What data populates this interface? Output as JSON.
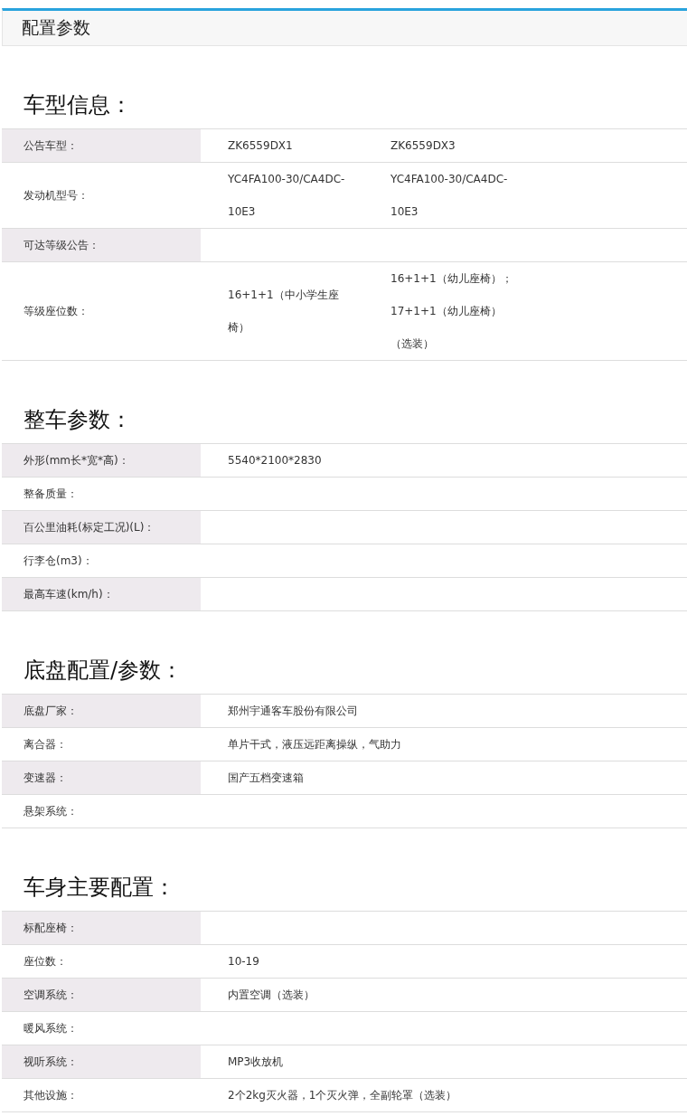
{
  "header": {
    "title": "配置参数"
  },
  "sections": [
    {
      "title": "车型信息：",
      "rows": [
        {
          "label": "公告车型：",
          "values": [
            "ZK6559DX1",
            "ZK6559DX3"
          ]
        },
        {
          "label": "发动机型号：",
          "values": [
            "YC4FA100-30/CA4DC-10E3",
            "YC4FA100-30/CA4DC-10E3"
          ]
        },
        {
          "label": "可达等级公告："
        },
        {
          "label": "等级座位数：",
          "values": [
            "16+1+1（中小学生座椅）",
            "16+1+1（幼儿座椅）；17+1+1（幼儿座椅）（选装）"
          ]
        }
      ]
    },
    {
      "title": "整车参数：",
      "rows": [
        {
          "label": "外形(mm长*宽*高)：",
          "values": [
            "5540*2100*2830"
          ]
        },
        {
          "label": "整备质量："
        },
        {
          "label": "百公里油耗(标定工况)(L)："
        },
        {
          "label": "行李仓(m3)："
        },
        {
          "label": "最高车速(km/h)："
        }
      ]
    },
    {
      "title": "底盘配置/参数：",
      "rows": [
        {
          "label": "底盘厂家：",
          "values": [
            "郑州宇通客车股份有限公司"
          ]
        },
        {
          "label": "离合器：",
          "values": [
            "单片干式，液压远距离操纵，气助力"
          ]
        },
        {
          "label": "变速器：",
          "values": [
            "国产五档变速箱"
          ]
        },
        {
          "label": "悬架系统："
        }
      ]
    },
    {
      "title": "车身主要配置：",
      "rows": [
        {
          "label": "标配座椅："
        },
        {
          "label": "座位数：",
          "values": [
            "10-19"
          ]
        },
        {
          "label": "空调系统：",
          "values": [
            "内置空调（选装）"
          ]
        },
        {
          "label": "暖风系统："
        },
        {
          "label": "视听系统：",
          "values": [
            "MP3收放机"
          ]
        },
        {
          "label": "其他设施：",
          "values": [
            "2个2kg灭火器，1个灭火弹，全副轮罩（选装）"
          ]
        }
      ]
    }
  ]
}
